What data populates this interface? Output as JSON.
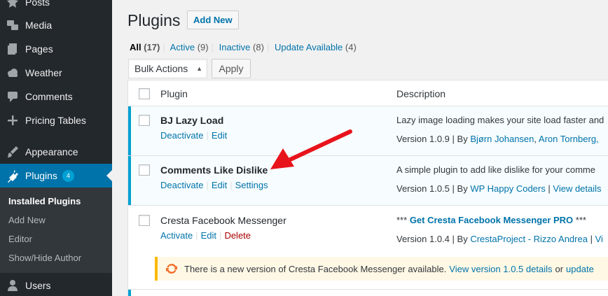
{
  "sidebar": {
    "items": [
      {
        "label": "Posts",
        "icon": "pin-icon"
      },
      {
        "label": "Media",
        "icon": "media-icon"
      },
      {
        "label": "Pages",
        "icon": "pages-icon"
      },
      {
        "label": "Weather",
        "icon": "cloud-icon"
      },
      {
        "label": "Comments",
        "icon": "comment-icon"
      },
      {
        "label": "Pricing Tables",
        "icon": "plus-icon"
      },
      {
        "label": "Appearance",
        "icon": "brush-icon"
      },
      {
        "label": "Plugins",
        "icon": "plug-icon",
        "badge": "4"
      },
      {
        "label": "Users",
        "icon": "user-icon"
      }
    ],
    "submenu": [
      "Installed Plugins",
      "Add New",
      "Editor",
      "Show/Hide Author"
    ]
  },
  "header": {
    "title": "Plugins",
    "add_new": "Add New"
  },
  "filters": [
    {
      "label": "All",
      "count": "(17)"
    },
    {
      "label": "Active",
      "count": "(9)"
    },
    {
      "label": "Inactive",
      "count": "(8)"
    },
    {
      "label": "Update Available",
      "count": "(4)"
    }
  ],
  "bulk": {
    "selected": "Bulk Actions",
    "apply": "Apply"
  },
  "table": {
    "columns": [
      "Plugin",
      "Description"
    ],
    "rows": [
      {
        "name": "BJ Lazy Load",
        "actions": [
          "Deactivate",
          "Edit"
        ],
        "description": "Lazy image loading makes your site load faster and",
        "meta": {
          "version": "Version 1.0.9",
          "by": "By",
          "authors": [
            "Bjørn Johansen",
            "Aron Tornberg,"
          ]
        }
      },
      {
        "name": "Comments Like Dislike",
        "actions": [
          "Deactivate",
          "Edit",
          "Settings"
        ],
        "description": "A simple plugin to add like dislike for your comme",
        "meta": {
          "version": "Version 1.0.5",
          "by": "By",
          "authors": [
            "WP Happy Coders"
          ],
          "details": "View details"
        }
      },
      {
        "name": "Cresta Facebook Messenger",
        "actions": [
          "Activate",
          "Edit",
          "Delete"
        ],
        "description_prefix": "***",
        "description_link": "Get Cresta Facebook Messenger PRO",
        "description_suffix": "***",
        "meta": {
          "version": "Version 1.0.4",
          "by": "By",
          "authors": [
            "CrestaProject - Rizzo Andrea"
          ],
          "details": "Vi"
        }
      }
    ]
  },
  "notice": {
    "text": "There is a new version of Cresta Facebook Messenger available.",
    "link": "View version 1.0.5 details",
    "or": "or",
    "update": "update"
  },
  "colors": {
    "accent": "#0073aa",
    "active_border": "#00a0d2",
    "arrow": "#e8141c"
  }
}
